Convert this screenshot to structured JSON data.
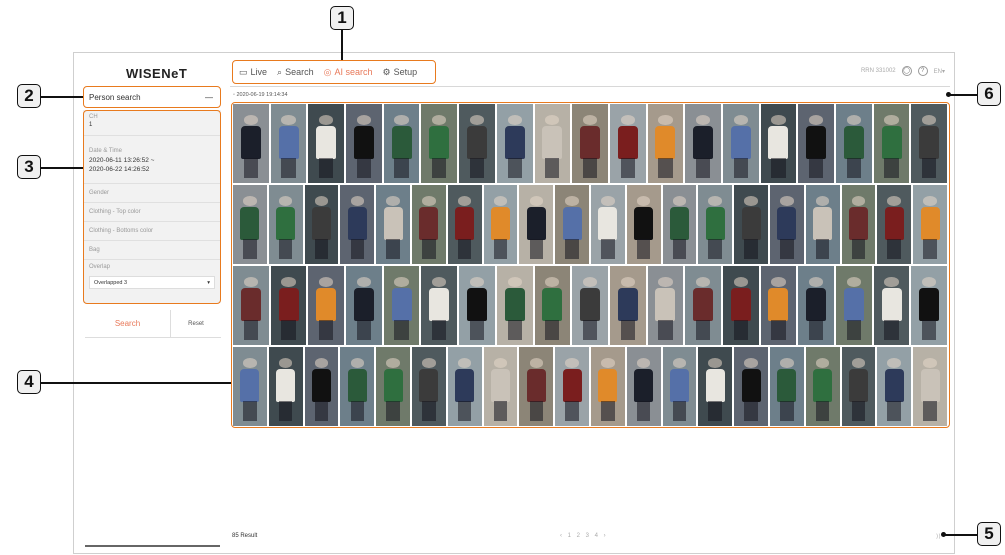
{
  "app": {
    "logo": "WISENeT"
  },
  "menu": [
    {
      "icon": "monitor-icon",
      "glyph": "▭",
      "label": "Live",
      "active": false
    },
    {
      "icon": "search-icon",
      "glyph": "⌕",
      "label": "Search",
      "active": false
    },
    {
      "icon": "ai-icon",
      "glyph": "◎",
      "label": "AI search",
      "active": true
    },
    {
      "icon": "gear-icon",
      "glyph": "⚙",
      "label": "Setup",
      "active": false
    }
  ],
  "top_right": {
    "text": "RRN 331002",
    "icons": [
      "user-icon",
      "help-icon",
      "language-icon"
    ],
    "lang": "EN▾"
  },
  "panel": {
    "title": "Person search",
    "collapse_glyph": "—",
    "ch_label": "CH",
    "ch_value": "1",
    "date_label": "Date & Time",
    "date_value_1": "2020-06-11 13:26:52 ~",
    "date_value_2": "2020-06-22 14:26:52",
    "gender_label": "Gender",
    "top_color_label": "Clothing - Top color",
    "bottom_color_label": "Clothing - Bottoms color",
    "bag_label": "Bag",
    "overlap_label": "Overlap",
    "overlap_value": "Overlapped 3",
    "search_button": "Search",
    "reset_button": "Reset"
  },
  "content": {
    "timestamp": "◦ 2020-06-19 19:14:34",
    "result": "85 Result",
    "pager": "‹ 1 2 3 4 ›",
    "corner": "⟩⟩"
  },
  "callouts": {
    "labels": [
      "1",
      "2",
      "3",
      "4",
      "5",
      "6"
    ]
  },
  "colors": {
    "accent": "#e8795a",
    "callout": "#e87a1e"
  }
}
